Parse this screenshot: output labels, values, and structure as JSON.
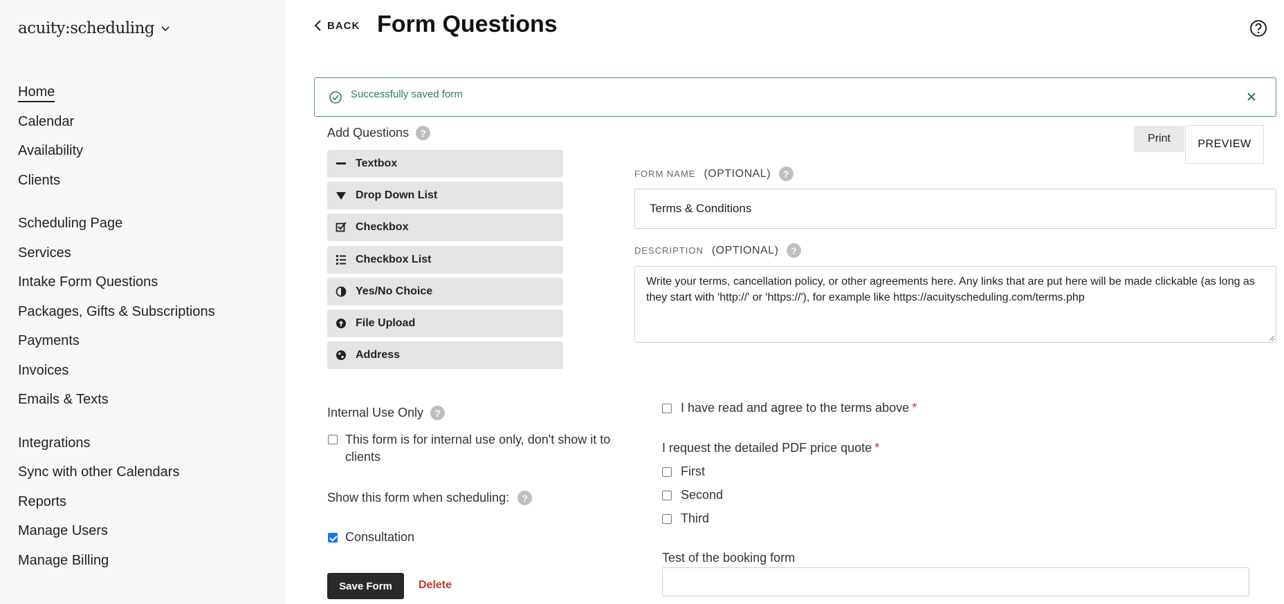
{
  "brand": {
    "logo_text": "acuity:scheduling"
  },
  "sidebar": {
    "groups": [
      [
        "Home",
        "Calendar",
        "Availability",
        "Clients"
      ],
      [
        "Scheduling Page",
        "Services",
        "Intake Form Questions",
        "Packages, Gifts & Subscriptions",
        "Payments",
        "Invoices",
        "Emails & Texts"
      ],
      [
        "Integrations",
        "Sync with other Calendars",
        "Reports",
        "Manage Users",
        "Manage Billing"
      ]
    ],
    "active": "Home"
  },
  "header": {
    "back_label": "BACK",
    "title": "Form Questions"
  },
  "alert": {
    "message": "Successfully saved form"
  },
  "add_questions": {
    "title": "Add Questions",
    "buttons": [
      "Textbox",
      "Drop Down List",
      "Checkbox",
      "Checkbox List",
      "Yes/No Choice",
      "File Upload",
      "Address"
    ]
  },
  "actions": {
    "print_label": "Print",
    "preview_label": "PREVIEW",
    "save_label": "Save Form",
    "delete_label": "Delete"
  },
  "form": {
    "name_label": "FORM NAME",
    "name_optional": "(OPTIONAL)",
    "name_value": "Terms & Conditions",
    "desc_label": "DESCRIPTION",
    "desc_optional": "(OPTIONAL)",
    "desc_value": "Write your terms, cancellation policy, or other agreements here. Any links that are put here will be made clickable (as long as they start with 'http://' or 'https://'), for example like https://acuityscheduling.com/terms.php"
  },
  "settings": {
    "internal_title": "Internal Use Only",
    "internal_checkbox_label": "This form is for internal use only, don't show it to clients",
    "internal_checked": false,
    "show_title": "Show this form when scheduling:",
    "types": [
      {
        "label": "Consultation",
        "checked": true
      }
    ]
  },
  "preview": {
    "agree_label": "I have read and agree to the terms above",
    "required_mark": "*",
    "list_question": "I request the detailed PDF price quote",
    "list_options": [
      "First",
      "Second",
      "Third"
    ],
    "text_question": "Test of the booking form"
  },
  "colors": {
    "success": "#2e7d4f",
    "danger": "#c0392b",
    "primary_dark": "#2a2a2a",
    "checkbox_blue": "#1a73e8"
  }
}
